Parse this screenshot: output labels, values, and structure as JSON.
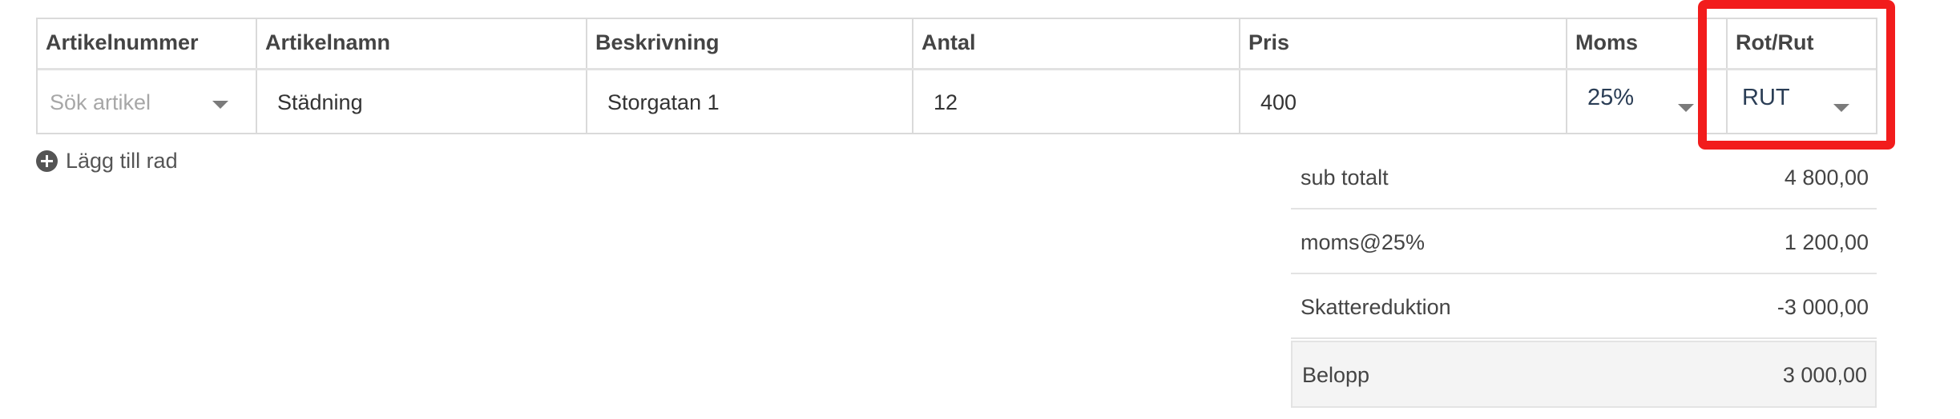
{
  "table": {
    "headers": [
      "Artikelnummer",
      "Artikelnamn",
      "Beskrivning",
      "Antal",
      "Pris",
      "Moms",
      "Rot/Rut"
    ],
    "row": {
      "artikel_placeholder": "Sök artikel",
      "artikelnamn": "Städning",
      "beskrivning": "Storgatan 1",
      "antal": "12",
      "pris": "400",
      "moms": "25%",
      "rot_rut": "RUT"
    }
  },
  "add_row_label": "Lägg till rad",
  "totals": [
    {
      "label": "sub totalt",
      "value": "4 800,00"
    },
    {
      "label": "moms@25%",
      "value": "1 200,00"
    },
    {
      "label": "Skattereduktion",
      "value": "-3 000,00"
    },
    {
      "label": "Belopp",
      "value": "3 000,00"
    }
  ],
  "colors": {
    "highlight": "#f21c1c",
    "border": "#dadada",
    "total_row_bg": "#f4f4f4"
  }
}
